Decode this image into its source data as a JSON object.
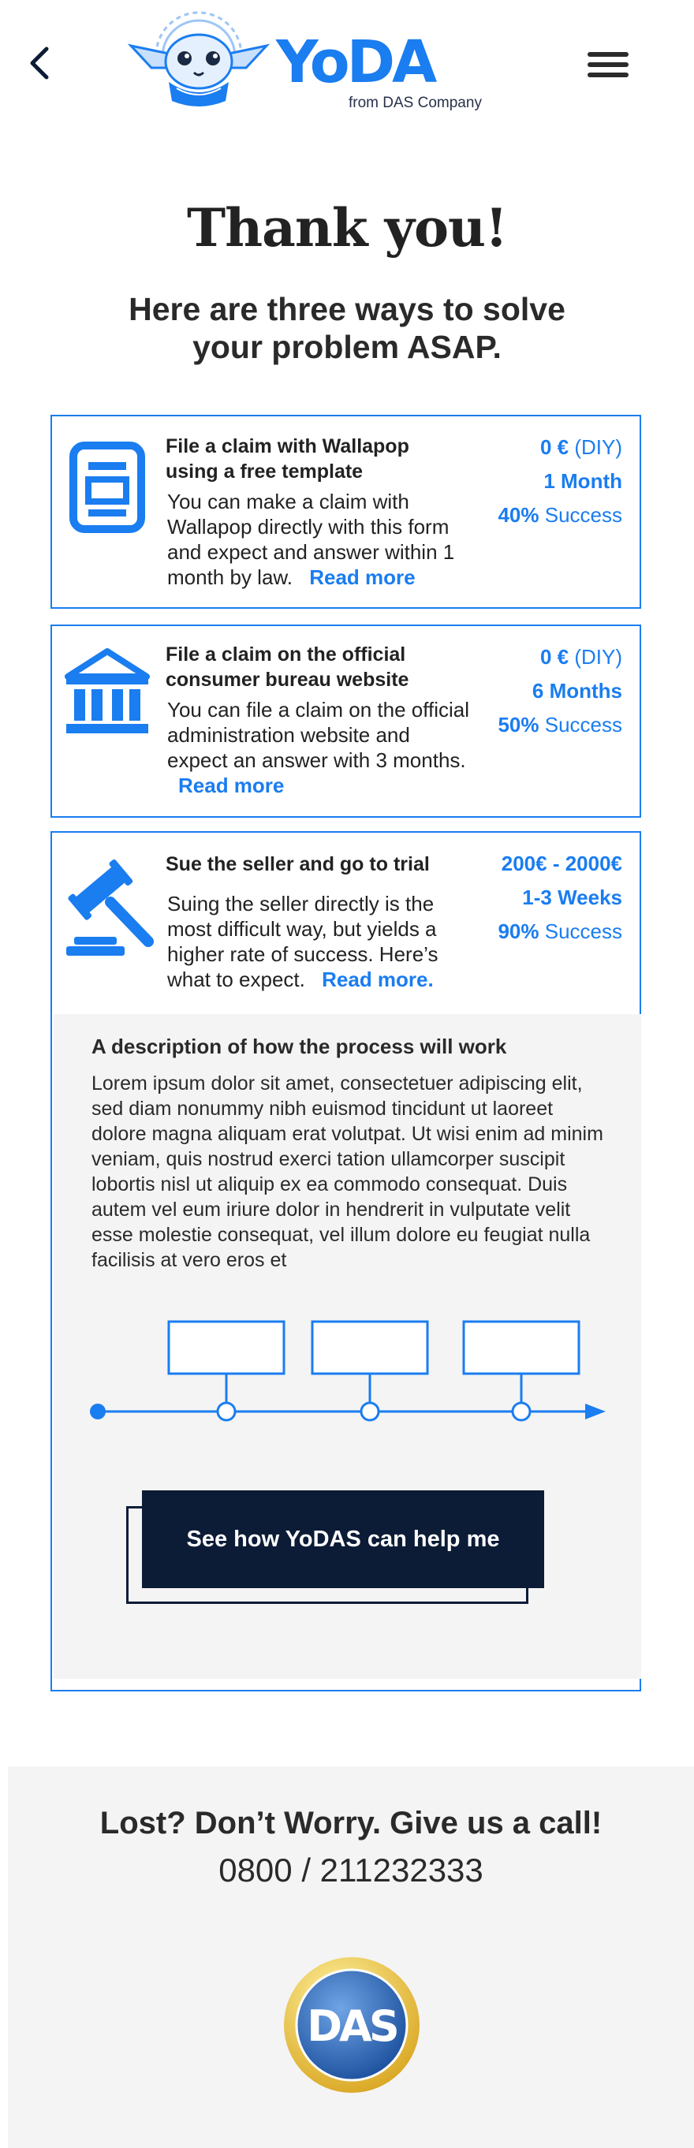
{
  "header": {
    "logo_text": "YoDA",
    "logo_sub": "from DAS Company"
  },
  "hero": {
    "title": "Thank you!",
    "subtitle": "Here are three ways to solve your problem ASAP."
  },
  "options": [
    {
      "icon": "document-template-icon",
      "title": "File a claim with Wallapop using a free template",
      "description": "You can make a claim with Wallapop directly with this form and expect and answer within 1 month by law.",
      "read_more": "Read more",
      "cost": "0 €",
      "cost_note": "(DIY)",
      "duration": "1 Month",
      "success_rate": "40%",
      "success_label": "Success"
    },
    {
      "icon": "government-building-icon",
      "title": "File a claim on the official consumer bureau website",
      "description": "You can file a claim on the official administration website and expect an answer with 3 months.",
      "read_more": "Read more",
      "cost": "0 €",
      "cost_note": "(DIY)",
      "duration": "6 Months",
      "success_rate": "50%",
      "success_label": "Success"
    },
    {
      "icon": "gavel-icon",
      "title": "Sue the seller and go to trial",
      "description": "Suing the seller directly is the most difficult way, but yields a higher rate of success. Here’s what to expect.",
      "read_more": "Read more.",
      "cost": "200€ - 2000€",
      "cost_note": "",
      "duration": "1-3 Weeks",
      "success_rate": "90%",
      "success_label": "Success",
      "process": {
        "title": "A description of how the process will work",
        "body": "Lorem ipsum dolor sit amet, consectetuer adipiscing elit, sed diam nonummy nibh euismod tincidunt ut laoreet dolore magna aliquam erat volutpat. Ut wisi enim ad minim veniam, quis nostrud exerci tation ullamcorper suscipit lobortis nisl ut aliquip ex ea commodo consequat. Duis autem vel eum iriure dolor in hendrerit in vulputate velit esse molestie consequat, vel illum dolore eu feugiat nulla facilisis at vero eros et",
        "cta": "See how YoDAS can help me"
      }
    }
  ],
  "footer": {
    "title": "Lost? Don’t Worry. Give us a call!",
    "phone": "0800 / 211232333",
    "logo_text": "DAS"
  },
  "colors": {
    "accent": "#1a7df0",
    "navy": "#0c1c36",
    "panel": "#f4f4f5",
    "gold": "#e8c43a"
  }
}
